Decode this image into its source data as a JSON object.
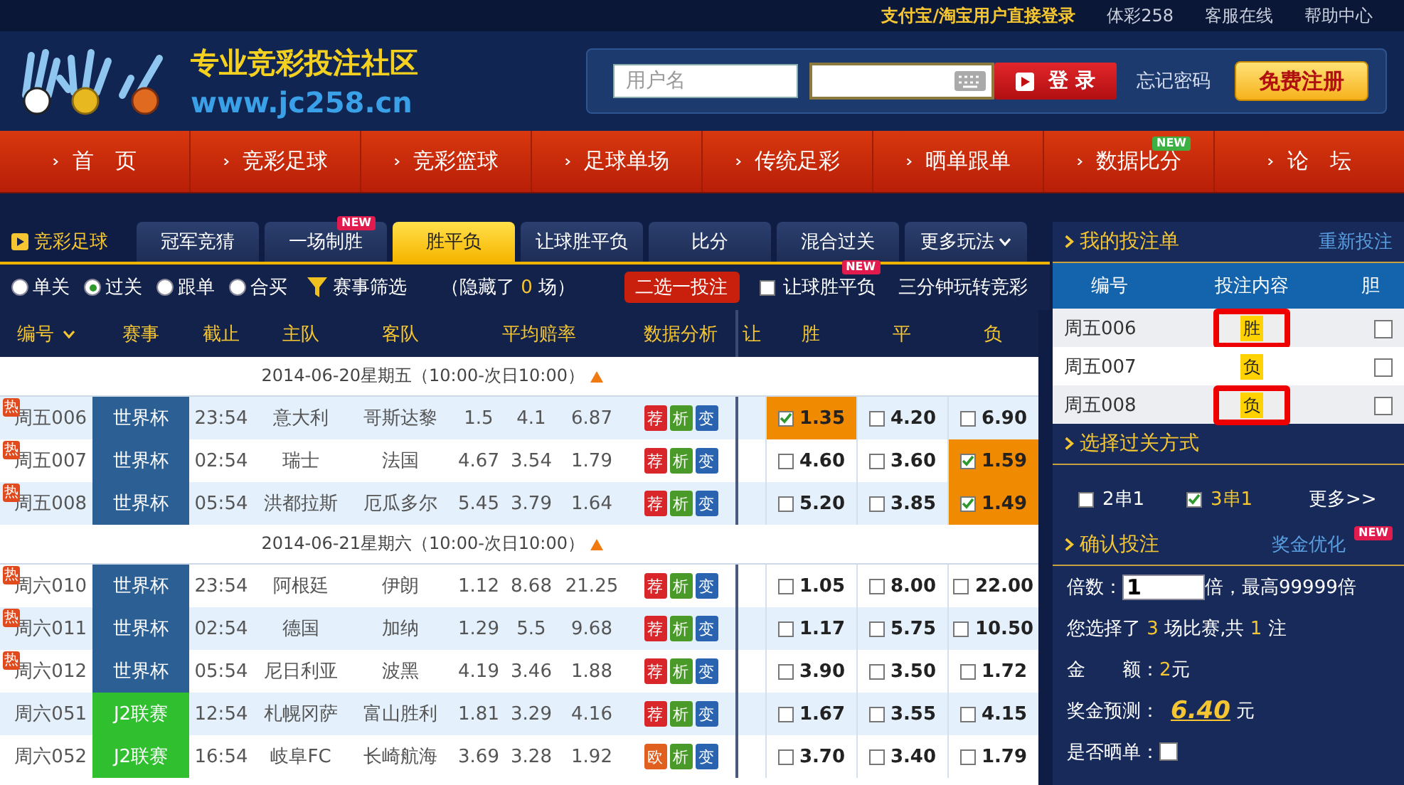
{
  "top_links": [
    {
      "text": "支付宝/淘宝用户直接登录",
      "kind": "accent"
    },
    {
      "text": "体彩258",
      "kind": "plain"
    },
    {
      "text": "客服在线",
      "kind": "plain"
    },
    {
      "text": "帮助中心",
      "kind": "plain"
    }
  ],
  "logo": {
    "title": "专业竞彩投注社区",
    "url": "www.jc258.cn"
  },
  "login": {
    "username_placeholder": "用户名",
    "login_button": "登 录",
    "forgot": "忘记密码",
    "register": "免费注册"
  },
  "nav": [
    {
      "label": "首　页"
    },
    {
      "label": "竞彩足球"
    },
    {
      "label": "竞彩篮球"
    },
    {
      "label": "足球单场"
    },
    {
      "label": "传统足彩"
    },
    {
      "label": "晒单跟单"
    },
    {
      "label": "数据比分",
      "badge": "NEW"
    },
    {
      "label": "论　坛"
    }
  ],
  "section_label": "竞彩足球",
  "tabs": [
    {
      "label": "冠军竞猜",
      "selected": false
    },
    {
      "label": "一场制胜",
      "selected": false,
      "badge": "NEW"
    },
    {
      "label": "胜平负",
      "selected": true
    },
    {
      "label": "让球胜平负",
      "selected": false
    },
    {
      "label": "比分",
      "selected": false
    },
    {
      "label": "混合过关",
      "selected": false
    },
    {
      "label": "更多玩法",
      "selected": false,
      "dropdown": true
    }
  ],
  "filters": {
    "modes": [
      {
        "label": "单关",
        "selected": false
      },
      {
        "label": "过关",
        "selected": true
      },
      {
        "label": "跟单",
        "selected": false
      },
      {
        "label": "合买",
        "selected": false
      }
    ],
    "filter_button": "赛事筛选",
    "hidden_prefix": "（隐藏了",
    "hidden_count": "0",
    "hidden_suffix": "场）",
    "pick_button": "二选一投注",
    "handicap_toggle": {
      "label": "让球胜平负",
      "checked": false,
      "badge": "NEW"
    },
    "guide_link": "三分钟玩转竞彩"
  },
  "table": {
    "columns": [
      "编号",
      "赛事",
      "截止",
      "主队",
      "客队",
      "平均赔率",
      "数据分析",
      "让",
      "胜",
      "平",
      "负"
    ],
    "groups": [
      {
        "date": "2014-06-20星期五（10:00-次日10:00）",
        "rows": [
          {
            "badge": "热",
            "id": "周五006",
            "league": "世界杯",
            "color": "#2c5f93",
            "deadline": "23:54",
            "home": "意大利",
            "away": "哥斯达黎",
            "avg_odds": [
              "1.5",
              "4.1",
              "6.87"
            ],
            "analysis": [
              {
                "kind": "tip",
                "label": "荐"
              },
              {
                "kind": "analysis",
                "label": "析"
              },
              {
                "kind": "change",
                "label": "变"
              }
            ],
            "odds": [
              {
                "value": "1.35",
                "checked": true
              },
              {
                "value": "4.20",
                "checked": false
              },
              {
                "value": "6.90",
                "checked": false
              }
            ]
          },
          {
            "badge": "热",
            "id": "周五007",
            "league": "世界杯",
            "color": "#2c5f93",
            "deadline": "02:54",
            "home": "瑞士",
            "away": "法国",
            "avg_odds": [
              "4.67",
              "3.54",
              "1.79"
            ],
            "analysis": [
              {
                "kind": "tip",
                "label": "荐"
              },
              {
                "kind": "analysis",
                "label": "析"
              },
              {
                "kind": "change",
                "label": "变"
              }
            ],
            "odds": [
              {
                "value": "4.60",
                "checked": false
              },
              {
                "value": "3.60",
                "checked": false
              },
              {
                "value": "1.59",
                "checked": true
              }
            ]
          },
          {
            "badge": "热",
            "id": "周五008",
            "league": "世界杯",
            "color": "#2c5f93",
            "deadline": "05:54",
            "home": "洪都拉斯",
            "away": "厄瓜多尔",
            "avg_odds": [
              "5.45",
              "3.79",
              "1.64"
            ],
            "analysis": [
              {
                "kind": "tip",
                "label": "荐"
              },
              {
                "kind": "analysis",
                "label": "析"
              },
              {
                "kind": "change",
                "label": "变"
              }
            ],
            "odds": [
              {
                "value": "5.20",
                "checked": false
              },
              {
                "value": "3.85",
                "checked": false
              },
              {
                "value": "1.49",
                "checked": true
              }
            ]
          }
        ]
      },
      {
        "date": "2014-06-21星期六（10:00-次日10:00）",
        "rows": [
          {
            "badge": "热",
            "id": "周六010",
            "league": "世界杯",
            "color": "#2c5f93",
            "deadline": "23:54",
            "home": "阿根廷",
            "away": "伊朗",
            "avg_odds": [
              "1.12",
              "8.68",
              "21.25"
            ],
            "analysis": [
              {
                "kind": "tip",
                "label": "荐"
              },
              {
                "kind": "analysis",
                "label": "析"
              },
              {
                "kind": "change",
                "label": "变"
              }
            ],
            "odds": [
              {
                "value": "1.05",
                "checked": false
              },
              {
                "value": "8.00",
                "checked": false
              },
              {
                "value": "22.00",
                "checked": false
              }
            ]
          },
          {
            "badge": "热",
            "id": "周六011",
            "league": "世界杯",
            "color": "#2c5f93",
            "deadline": "02:54",
            "home": "德国",
            "away": "加纳",
            "avg_odds": [
              "1.29",
              "5.5",
              "9.68"
            ],
            "analysis": [
              {
                "kind": "tip",
                "label": "荐"
              },
              {
                "kind": "analysis",
                "label": "析"
              },
              {
                "kind": "change",
                "label": "变"
              }
            ],
            "odds": [
              {
                "value": "1.17",
                "checked": false
              },
              {
                "value": "5.75",
                "checked": false
              },
              {
                "value": "10.50",
                "checked": false
              }
            ]
          },
          {
            "badge": "热",
            "id": "周六012",
            "league": "世界杯",
            "color": "#2c5f93",
            "deadline": "05:54",
            "home": "尼日利亚",
            "away": "波黑",
            "avg_odds": [
              "4.19",
              "3.46",
              "1.88"
            ],
            "analysis": [
              {
                "kind": "tip",
                "label": "荐"
              },
              {
                "kind": "analysis",
                "label": "析"
              },
              {
                "kind": "change",
                "label": "变"
              }
            ],
            "odds": [
              {
                "value": "3.90",
                "checked": false
              },
              {
                "value": "3.50",
                "checked": false
              },
              {
                "value": "1.72",
                "checked": false
              }
            ]
          },
          {
            "id": "周六051",
            "league": "J2联赛",
            "color": "#2fbf2f",
            "deadline": "12:54",
            "home": "札幌冈萨",
            "away": "富山胜利",
            "avg_odds": [
              "1.81",
              "3.29",
              "4.16"
            ],
            "analysis": [
              {
                "kind": "tip",
                "label": "荐"
              },
              {
                "kind": "analysis",
                "label": "析"
              },
              {
                "kind": "change",
                "label": "变"
              }
            ],
            "odds": [
              {
                "value": "1.67",
                "checked": false
              },
              {
                "value": "3.55",
                "checked": false
              },
              {
                "value": "4.15",
                "checked": false
              }
            ]
          },
          {
            "id": "周六052",
            "league": "J2联赛",
            "color": "#2fbf2f",
            "deadline": "16:54",
            "home": "岐阜FC",
            "away": "长崎航海",
            "avg_odds": [
              "3.69",
              "3.28",
              "1.92"
            ],
            "analysis": [
              {
                "kind": "euro",
                "label": "欧"
              },
              {
                "kind": "analysis",
                "label": "析"
              },
              {
                "kind": "change",
                "label": "变"
              }
            ],
            "odds": [
              {
                "value": "3.70",
                "checked": false
              },
              {
                "value": "3.40",
                "checked": false
              },
              {
                "value": "1.79",
                "checked": false
              }
            ]
          }
        ]
      }
    ]
  },
  "bet_slip": {
    "title": "我的投注单",
    "reset": "重新投注",
    "columns": [
      "编号",
      "投注内容",
      "胆"
    ],
    "bets": [
      {
        "id": "周五006",
        "pick": "胜",
        "highlighted": true,
        "banker": false
      },
      {
        "id": "周五007",
        "pick": "负",
        "highlighted": false,
        "banker": false
      },
      {
        "id": "周五008",
        "pick": "负",
        "highlighted": true,
        "banker": false
      }
    ]
  },
  "pass_type": {
    "title": "选择过关方式",
    "options": [
      {
        "label": "2串1",
        "checked": false
      },
      {
        "label": "3串1",
        "checked": true
      }
    ],
    "more": "更多>>"
  },
  "confirm": {
    "title": "确认投注",
    "optimize": "奖金优化",
    "optimize_badge": "NEW",
    "multiplier_label": "倍数：",
    "multiplier": "1",
    "multiplier_suffix": "倍，最高99999倍",
    "selection": {
      "prefix": "您选择了",
      "matches": "3",
      "middle": "场比赛,共",
      "bets": "1",
      "suffix": "注"
    },
    "amount": {
      "label": "金　　额：",
      "value": "2",
      "unit": "元"
    },
    "prize": {
      "label": "奖金预测：",
      "value": "6.40",
      "unit": "元"
    },
    "share": {
      "label": "是否晒单：",
      "checked": false
    }
  }
}
